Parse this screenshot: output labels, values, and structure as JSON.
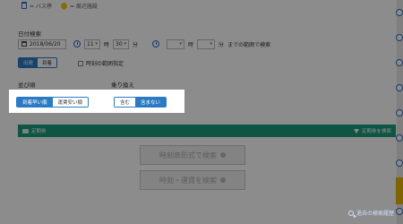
{
  "legend": {
    "bus_label": "= バス停",
    "poi_label": "= 周辺施設"
  },
  "date_search": {
    "label": "日付検索",
    "date_value": "2018/06/20",
    "hour_value": "11",
    "hour_unit": "時",
    "minute_value": "30",
    "minute_unit": "分",
    "range_hour_unit": "時",
    "range_minute_unit": "分",
    "range_suffix": "までの範囲で検索"
  },
  "dep_arr": {
    "depart": "出発",
    "arrive": "到着"
  },
  "time_range_checkbox": "時刻の範囲指定",
  "sort": {
    "label": "並び順",
    "options": [
      "到着早い順",
      "運賃安い順"
    ],
    "selected": "到着早い順"
  },
  "transfer": {
    "label": "乗り換え",
    "options": [
      "含む",
      "含まない"
    ],
    "selected": "含まない"
  },
  "green_bar": {
    "left_label": "定期券",
    "right_label": "定期券を検索"
  },
  "buttons": {
    "timetable": "時刻表形式で検索",
    "time_fare": "時刻・運賃を検索"
  },
  "history_link": "過去の検索履歴",
  "colors": {
    "accent": "#2b7bc4",
    "green": "#1a9c7a",
    "overlay": "rgba(0,0,0,0.45)"
  }
}
